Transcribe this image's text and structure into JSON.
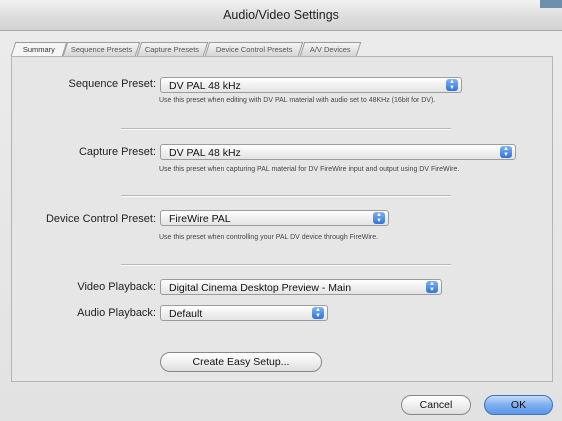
{
  "window": {
    "title": "Audio/Video Settings"
  },
  "tabs": [
    {
      "label": "Summary"
    },
    {
      "label": "Sequence Presets"
    },
    {
      "label": "Capture Presets"
    },
    {
      "label": "Device Control Presets"
    },
    {
      "label": "A/V Devices"
    }
  ],
  "sequence_preset": {
    "label": "Sequence Preset:",
    "value": "DV PAL 48 kHz",
    "hint": "Use this preset when editing with DV PAL material with audio set to 48KHz (16bit for DV)."
  },
  "capture_preset": {
    "label": "Capture Preset:",
    "value": "DV PAL 48 kHz",
    "hint": "Use this preset when capturing PAL material for DV FireWire input and output using DV FireWire."
  },
  "device_control_preset": {
    "label": "Device Control Preset:",
    "value": "FireWire PAL",
    "hint": "Use this preset when controlling your PAL DV device through FireWire."
  },
  "video_playback": {
    "label": "Video Playback:",
    "value": "Digital Cinema Desktop Preview - Main"
  },
  "audio_playback": {
    "label": "Audio Playback:",
    "value": "Default"
  },
  "buttons": {
    "create_easy_setup": "Create Easy Setup...",
    "cancel": "Cancel",
    "ok": "OK"
  },
  "icons": {
    "popup_arrows": "up-down-arrows-icon"
  }
}
